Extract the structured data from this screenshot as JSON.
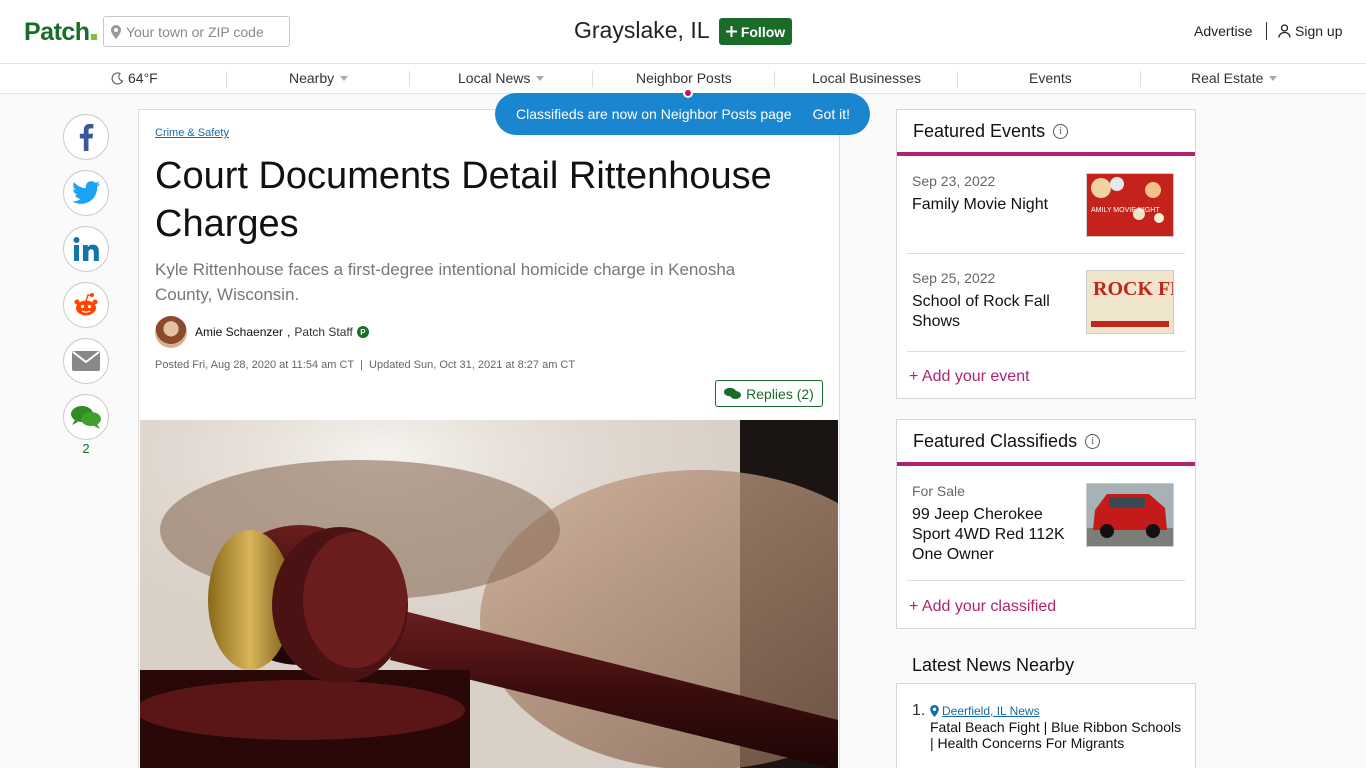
{
  "header": {
    "logo": "Patch",
    "search_placeholder": "Your town or ZIP code",
    "town": "Grayslake, IL",
    "follow_label": "Follow",
    "advertise": "Advertise",
    "signup": "Sign up"
  },
  "nav": {
    "weather": "64°F",
    "items": [
      {
        "label": "Nearby"
      },
      {
        "label": "Local News"
      },
      {
        "label": "Neighbor Posts"
      },
      {
        "label": "Local Businesses"
      },
      {
        "label": "Events"
      },
      {
        "label": "Real Estate"
      }
    ]
  },
  "tooltip": {
    "message": "Classifieds are now on Neighbor Posts page",
    "dismiss": "Got it!"
  },
  "share": {
    "comment_count": "2"
  },
  "article": {
    "category": "Crime & Safety",
    "headline": "Court Documents Detail Rittenhouse Charges",
    "dek": "Kyle Rittenhouse faces a first-degree intentional homicide charge in Kenosha County, Wisconsin.",
    "author": "Amie Schaenzer",
    "author_role": "Patch Staff",
    "badge": "P",
    "posted": "Posted Fri, Aug 28, 2020 at 11:54 am CT  |  Updated Sun, Oct 31, 2021 at 8:27 am CT",
    "replies": "Replies (2)"
  },
  "featured_events": {
    "title": "Featured Events",
    "items": [
      {
        "date": "Sep 23, 2022",
        "title": "Family Movie Night",
        "thumb_text": "AMILY MOVIE NIGHT"
      },
      {
        "date": "Sep 25, 2022",
        "title": "School of Rock Fall Shows",
        "thumb_text": "ROCK FESTIVAL"
      }
    ],
    "add_label": "+ Add your event"
  },
  "featured_classifieds": {
    "title": "Featured Classifieds",
    "items": [
      {
        "category": "For Sale",
        "title": "99 Jeep Cherokee Sport 4WD Red 112K One Owner"
      }
    ],
    "add_label": "+ Add your classified"
  },
  "latest_news": {
    "title": "Latest News Nearby",
    "items": [
      {
        "num": "1.",
        "source": "Deerfield, IL News",
        "headline": "Fatal Beach Fight | Blue Ribbon Schools | Health Concerns For Migrants"
      }
    ]
  },
  "colors": {
    "brand_green": "#196d28",
    "accent_magenta": "#b0236f",
    "tooltip_blue": "#1a86d0",
    "link_blue": "#1768a6"
  }
}
